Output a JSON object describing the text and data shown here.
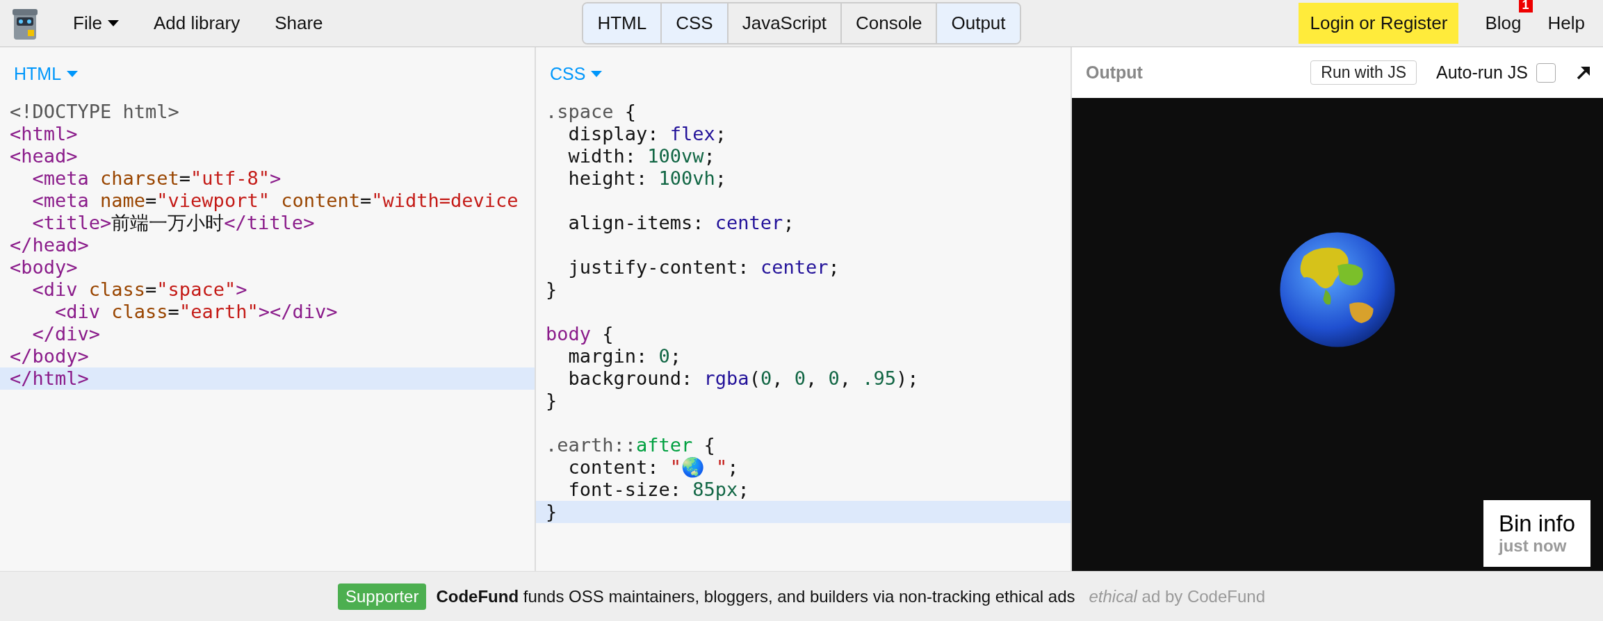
{
  "toolbar": {
    "menu": [
      {
        "label": "File",
        "dropdown": true
      },
      {
        "label": "Add library",
        "dropdown": false
      },
      {
        "label": "Share",
        "dropdown": false
      }
    ],
    "panels": [
      {
        "label": "HTML",
        "selected": true
      },
      {
        "label": "CSS",
        "selected": true
      },
      {
        "label": "JavaScript",
        "selected": false
      },
      {
        "label": "Console",
        "selected": false
      },
      {
        "label": "Output",
        "selected": true
      }
    ],
    "login": "Login or Register",
    "links": [
      {
        "label": "Blog",
        "badge": "1"
      },
      {
        "label": "Help"
      }
    ]
  },
  "editors": [
    {
      "title": "HTML",
      "kind": "html",
      "lines": [
        {
          "text": "<!DOCTYPE html>",
          "active": false
        },
        {
          "text": "<html>",
          "active": false
        },
        {
          "text": "<head>",
          "active": false
        },
        {
          "text": "  <meta charset=\"utf-8\">",
          "active": false
        },
        {
          "text": "  <meta name=\"viewport\" content=\"width=device",
          "active": false
        },
        {
          "text": "  <title>前端一万小时</title>",
          "active": false
        },
        {
          "text": "</head>",
          "active": false
        },
        {
          "text": "<body>",
          "active": false
        },
        {
          "text": "  <div class=\"space\">",
          "active": false
        },
        {
          "text": "    <div class=\"earth\"></div>",
          "active": false
        },
        {
          "text": "  </div>",
          "active": false
        },
        {
          "text": "</body>",
          "active": false
        },
        {
          "text": "</html>",
          "active": true
        }
      ]
    },
    {
      "title": "CSS",
      "kind": "css",
      "lines": [
        {
          "text": ".space {",
          "active": false
        },
        {
          "text": "  display: flex;",
          "active": false
        },
        {
          "text": "  width: 100vw;",
          "active": false
        },
        {
          "text": "  height: 100vh;",
          "active": false
        },
        {
          "active": false
        },
        {
          "text": "  align-items: center;",
          "active": false
        },
        {
          "active": false
        },
        {
          "text": "  justify-content: center;",
          "active": false
        },
        {
          "text": "}",
          "active": false
        },
        {
          "active": false
        },
        {
          "text": "body {",
          "active": false
        },
        {
          "text": "  margin: 0;",
          "active": false
        },
        {
          "text": "  background: rgba(0, 0, 0, .95);",
          "active": false
        },
        {
          "text": "}",
          "active": false
        },
        {
          "active": false
        },
        {
          "text": ".earth::after {",
          "active": false
        },
        {
          "text": "  content: \"🌏 \";",
          "active": false
        },
        {
          "text": "  font-size: 85px;",
          "active": false
        },
        {
          "text": "}",
          "active": true
        }
      ]
    }
  ],
  "output": {
    "title": "Output",
    "run_button": "Run with JS",
    "autorun": {
      "label": "Auto-run JS",
      "checked": false
    },
    "bin_info": {
      "title": "Bin info",
      "time": "just now"
    }
  },
  "ad": {
    "badge": "Supporter",
    "text": "**CodeFund** funds OSS maintainers, bloggers, and builders via non-tracking ethical ads",
    "credit": "*ethical* ad by CodeFund"
  }
}
